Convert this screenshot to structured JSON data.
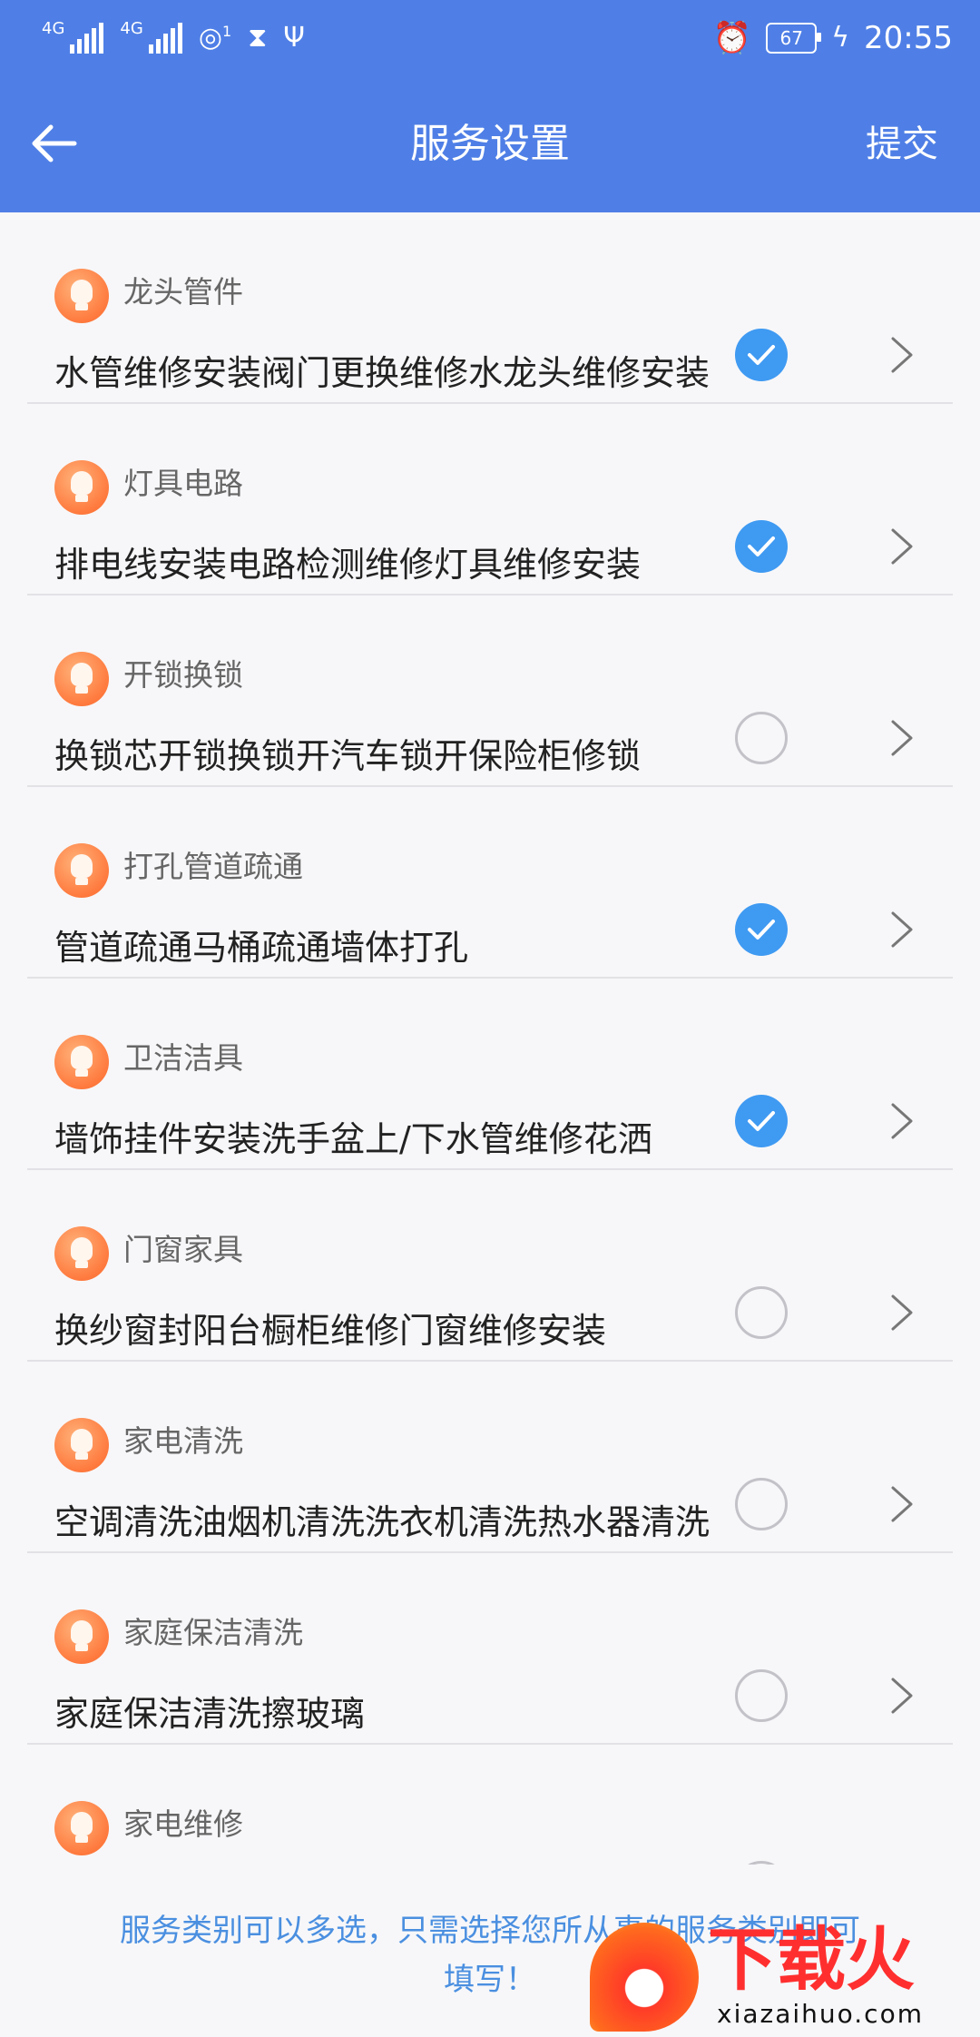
{
  "status_bar": {
    "signal1_label": "4G",
    "signal2_label": "4G",
    "wifi_badge": "1",
    "battery": "67",
    "time": "20:55"
  },
  "header": {
    "title": "服务设置",
    "submit_label": "提交"
  },
  "services": [
    {
      "category": "龙头管件",
      "description": "水管维修安装阀门更换维修水龙头维修安装",
      "checked": true
    },
    {
      "category": "灯具电路",
      "description": "排电线安装电路检测维修灯具维修安装",
      "checked": true
    },
    {
      "category": "开锁换锁",
      "description": "换锁芯开锁换锁开汽车锁开保险柜修锁",
      "checked": false
    },
    {
      "category": "打孔管道疏通",
      "description": "管道疏通马桶疏通墙体打孔",
      "checked": true
    },
    {
      "category": "卫洁洁具",
      "description": "墙饰挂件安装洗手盆上/下水管维修花洒",
      "checked": true
    },
    {
      "category": "门窗家具",
      "description": "换纱窗封阳台橱柜维修门窗维修安装",
      "checked": false
    },
    {
      "category": "家电清洗",
      "description": "空调清洗油烟机清洗洗衣机清洗热水器清洗",
      "checked": false
    },
    {
      "category": "家庭保洁清洗",
      "description": "家庭保洁清洗擦玻璃",
      "checked": false
    },
    {
      "category": "家电维修",
      "description": "",
      "checked": false
    }
  ],
  "footer": {
    "line1": "服务类别可以多选，只需选择您所从事的服务类别即可",
    "line2": "填写！"
  },
  "watermark": {
    "brand": "下载火",
    "url": "xiazaihuo.com"
  },
  "colors": {
    "primary": "#4f7fe6",
    "check_on": "#3f9af2",
    "icon_orange": "#ff7a3e"
  }
}
